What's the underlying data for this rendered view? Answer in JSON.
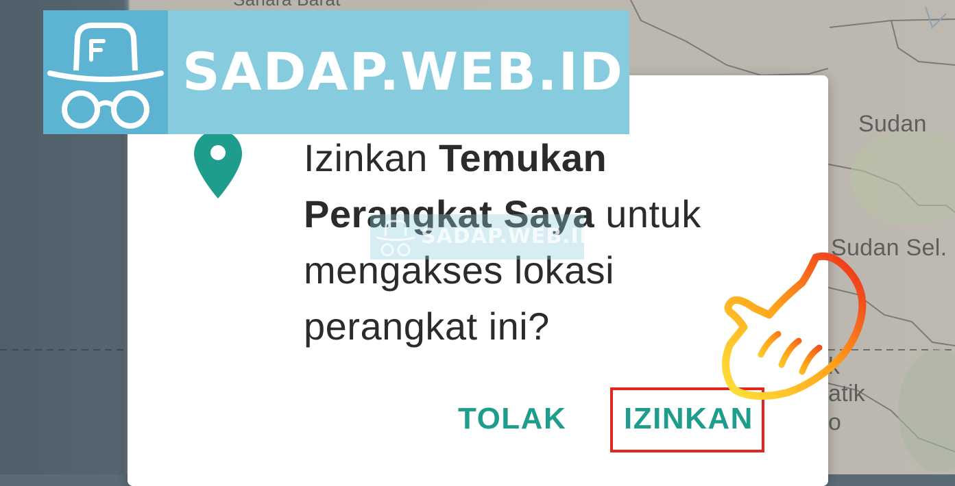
{
  "map": {
    "labels": {
      "sahara": "Sahara Barat",
      "sudan": "Sudan",
      "south_sudan": "Sudan Sel.",
      "partial_k": "k",
      "partial_atik": "atik",
      "partial_o": "o"
    }
  },
  "watermark": {
    "brand": "SADAP.WEB.ID",
    "icon": "spy-hat-glasses-icon"
  },
  "dialog": {
    "icon": "location-pin-icon",
    "message_prefix": "Izinkan ",
    "app_name": "Temukan Perangkat Saya",
    "message_suffix": " untuk mengakses lokasi perangkat ini?",
    "deny_label": "TOLAK",
    "allow_label": "IZINKAN"
  },
  "colors": {
    "accent": "#1e9d8c",
    "highlight": "#e0271e",
    "banner": "#86ccde",
    "banner_icon_bg": "#5cb3d2"
  }
}
